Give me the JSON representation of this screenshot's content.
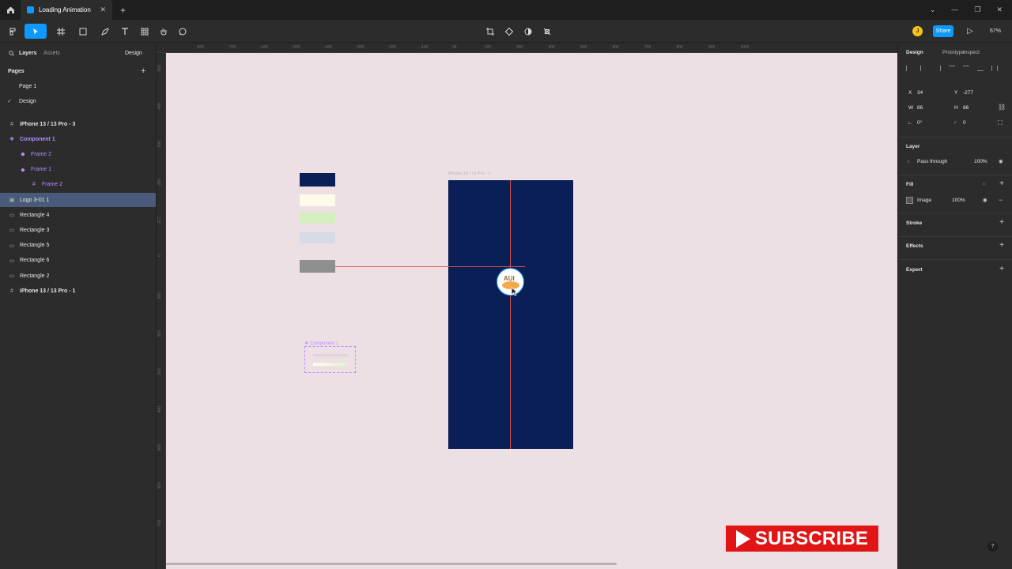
{
  "titlebar": {
    "tab_title": "Loading Animation",
    "new_tab": "+",
    "close": "✕",
    "win_min": "—",
    "win_max": "❐",
    "win_close": "✕",
    "chevron": "⌄"
  },
  "toolbar": {
    "share_label": "Share",
    "avatar_initial": "J",
    "zoom": "67%",
    "play": "▷"
  },
  "left_panel": {
    "tabs": {
      "layers": "Layers",
      "assets": "Assets",
      "design": "Design"
    },
    "pages_title": "Pages",
    "add_page": "+",
    "pages": [
      {
        "label": "Page 1",
        "current": false
      },
      {
        "label": "Design",
        "current": true,
        "check": "✓"
      }
    ],
    "layers": [
      {
        "label": "iPhone 13 / 13 Pro - 3",
        "icon": "#",
        "indent": 0,
        "kind": "frame"
      },
      {
        "label": "Component 1",
        "icon": "❖",
        "indent": 0,
        "kind": "component"
      },
      {
        "label": "Frame 2",
        "icon": "◆",
        "indent": 1,
        "kind": "instance"
      },
      {
        "label": "Frame 1",
        "icon": "◆",
        "indent": 1,
        "kind": "instance"
      },
      {
        "label": "Frame 2",
        "icon": "#",
        "indent": 2,
        "kind": "instance"
      },
      {
        "label": "Logo 3-01 1",
        "icon": "▣",
        "indent": 0,
        "kind": "image",
        "selected": true
      },
      {
        "label": "Rectangle 4",
        "icon": "▭",
        "indent": 0,
        "kind": "rect"
      },
      {
        "label": "Rectangle 3",
        "icon": "▭",
        "indent": 0,
        "kind": "rect"
      },
      {
        "label": "Rectangle 5",
        "icon": "▭",
        "indent": 0,
        "kind": "rect"
      },
      {
        "label": "Rectangle 6",
        "icon": "▭",
        "indent": 0,
        "kind": "rect"
      },
      {
        "label": "Rectangle 2",
        "icon": "▭",
        "indent": 0,
        "kind": "rect"
      },
      {
        "label": "iPhone 13 / 13 Pro - 1",
        "icon": "#",
        "indent": 0,
        "kind": "frame"
      }
    ]
  },
  "rulers": {
    "top": [
      "-800",
      "-700",
      "-600",
      "-500",
      "-400",
      "-300",
      "-200",
      "-100",
      "34",
      "120",
      "300",
      "400",
      "500",
      "600",
      "700",
      "800",
      "900",
      "1000"
    ],
    "left": [
      "-500",
      "-400",
      "-300",
      "-200",
      "-277",
      "0",
      "100",
      "200",
      "300",
      "400",
      "500",
      "600",
      "700"
    ]
  },
  "canvas": {
    "frame_label": "iPhone 13 / 13 Pro - 1",
    "component_label": "❖ Component 1",
    "frame_color": "#0a1f55",
    "swatch_colors": [
      "#0a1f55",
      "#fffbea",
      "#d4eec0",
      "#d6dbe6",
      "#8f8f8f"
    ],
    "logo_text": "AUI"
  },
  "right_panel": {
    "tabs": {
      "design": "Design",
      "prototype": "Prototype",
      "inspect": "Inspect"
    },
    "x_label": "X",
    "x_value": "34",
    "y_label": "Y",
    "y_value": "-277",
    "w_label": "W",
    "w_value": "86",
    "h_label": "H",
    "h_value": "86",
    "rotation": "0°",
    "radius": "0",
    "layer_title": "Layer",
    "blend_mode": "Pass through",
    "layer_opacity": "100%",
    "fill_title": "Fill",
    "fill_type": "Image",
    "fill_opacity": "100%",
    "stroke_title": "Stroke",
    "effects_title": "Effects",
    "export_title": "Export"
  },
  "overlay": {
    "subscribe": "SUBSCRIBE",
    "help": "?"
  },
  "colors": {
    "accent": "#0d99ff",
    "panel": "#2c2c2c",
    "canvas": "#ede0e4",
    "selection": "#4a5a7a",
    "component": "#b58cff",
    "subscribe": "#e01515"
  }
}
